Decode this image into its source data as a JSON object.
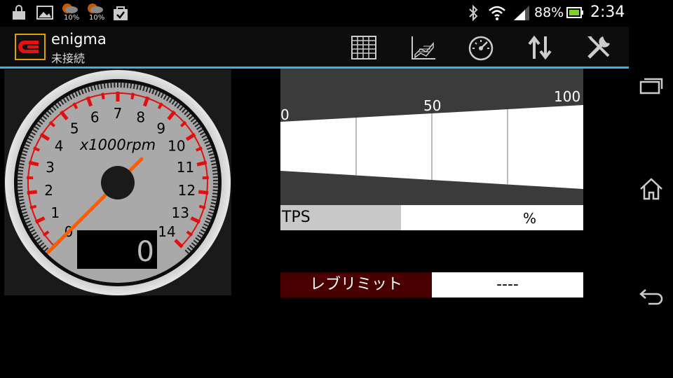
{
  "status_bar": {
    "icons": [
      "lock-bag-icon",
      "image-icon",
      "weather-rain-icon",
      "weather-rain-icon",
      "shopping-bag-check-icon",
      "bluetooth-icon",
      "wifi-icon",
      "signal-icon",
      "battery-icon"
    ],
    "weather1_percent": "10%",
    "weather2_percent": "10%",
    "battery_percent": "88%",
    "clock": "2:34"
  },
  "action_bar": {
    "title": "enigma",
    "subtitle": "未接続",
    "buttons": [
      "table-grid-icon",
      "map-chart-icon",
      "speedometer-icon",
      "up-down-arrows-icon",
      "tools-icon"
    ]
  },
  "nav_bar": {
    "buttons": [
      "recent-apps-icon",
      "home-icon",
      "back-icon"
    ]
  },
  "gauge": {
    "unit_label": "x1000rpm",
    "tick_labels": [
      "0",
      "1",
      "2",
      "3",
      "4",
      "5",
      "6",
      "7",
      "8",
      "9",
      "10",
      "11",
      "12",
      "13",
      "14"
    ],
    "min": 0,
    "max": 14,
    "needle_value": 0,
    "digital_value": "0"
  },
  "graph": {
    "scale_labels": [
      "0",
      "50",
      "100"
    ]
  },
  "tps": {
    "label": "TPS",
    "unit": "%",
    "bar_fraction": 0.397
  },
  "rev_limit": {
    "label": "レブリミット",
    "value": "----"
  },
  "colors": {
    "accent": "#33b5e5",
    "gauge_red": "#e01010",
    "needle": "#ff5a00",
    "rev_label_bg": "#4a0000"
  }
}
